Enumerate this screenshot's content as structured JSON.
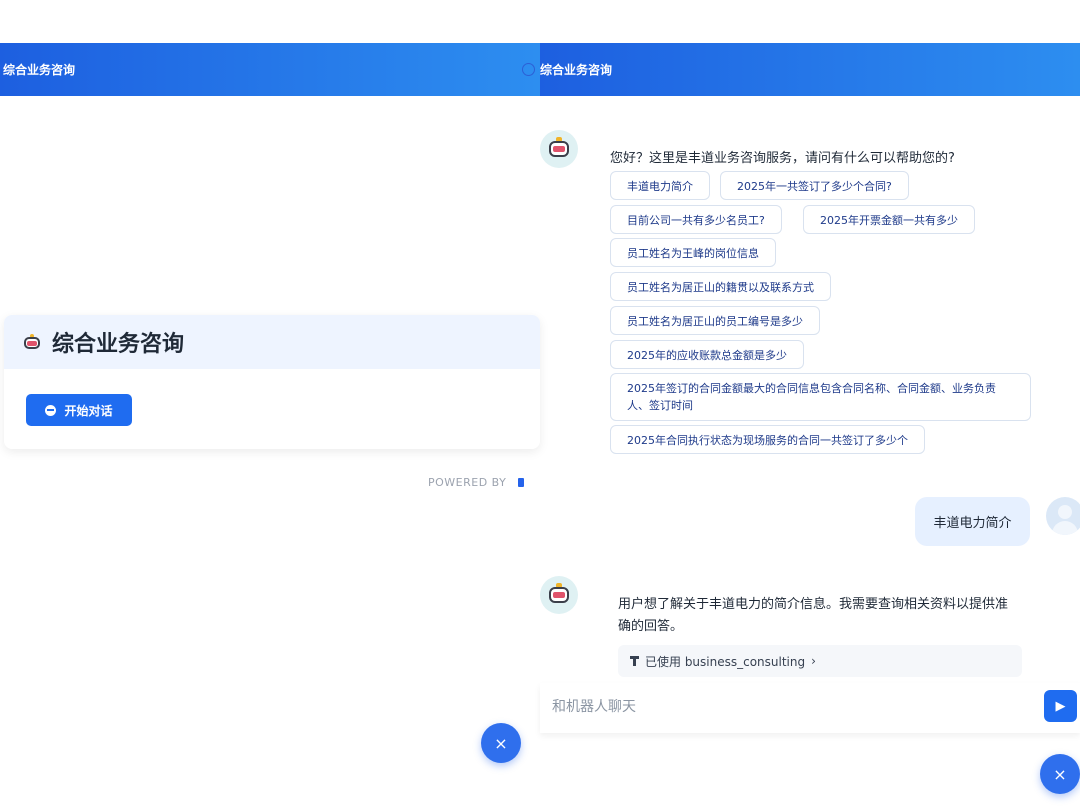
{
  "left": {
    "header_title": "综合业务咨询",
    "card_title": "综合业务咨询",
    "start_button": "开始对话",
    "powered_by": "POWERED BY"
  },
  "right": {
    "header_title": "综合业务咨询",
    "greeting": "您好？这里是丰道业务咨询服务，请问有什么可以帮助您的?",
    "suggestions": [
      "丰道电力简介",
      "2025年一共签订了多少个合同?",
      "目前公司一共有多少名员工?",
      "2025年开票金额一共有多少",
      "员工姓名为王峰的岗位信息",
      "员工姓名为居正山的籍贯以及联系方式",
      "员工姓名为居正山的员工编号是多少",
      "2025年的应收账款总金额是多少",
      "2025年签订的合同金额最大的合同信息包含合同名称、合同金额、业务负责人、签订时间",
      "2025年合同执行状态为现场服务的合同一共签订了多少个"
    ],
    "user_message": "丰道电力简介",
    "bot_reply": "用户想了解关于丰道电力的简介信息。我需要查询相关资料以提供准确的回答。",
    "tool_label": "已使用 business_consulting",
    "tool_chevron": "›",
    "input_placeholder": "和机器人聊天"
  },
  "icons": {
    "close": "×",
    "send": "▶"
  }
}
